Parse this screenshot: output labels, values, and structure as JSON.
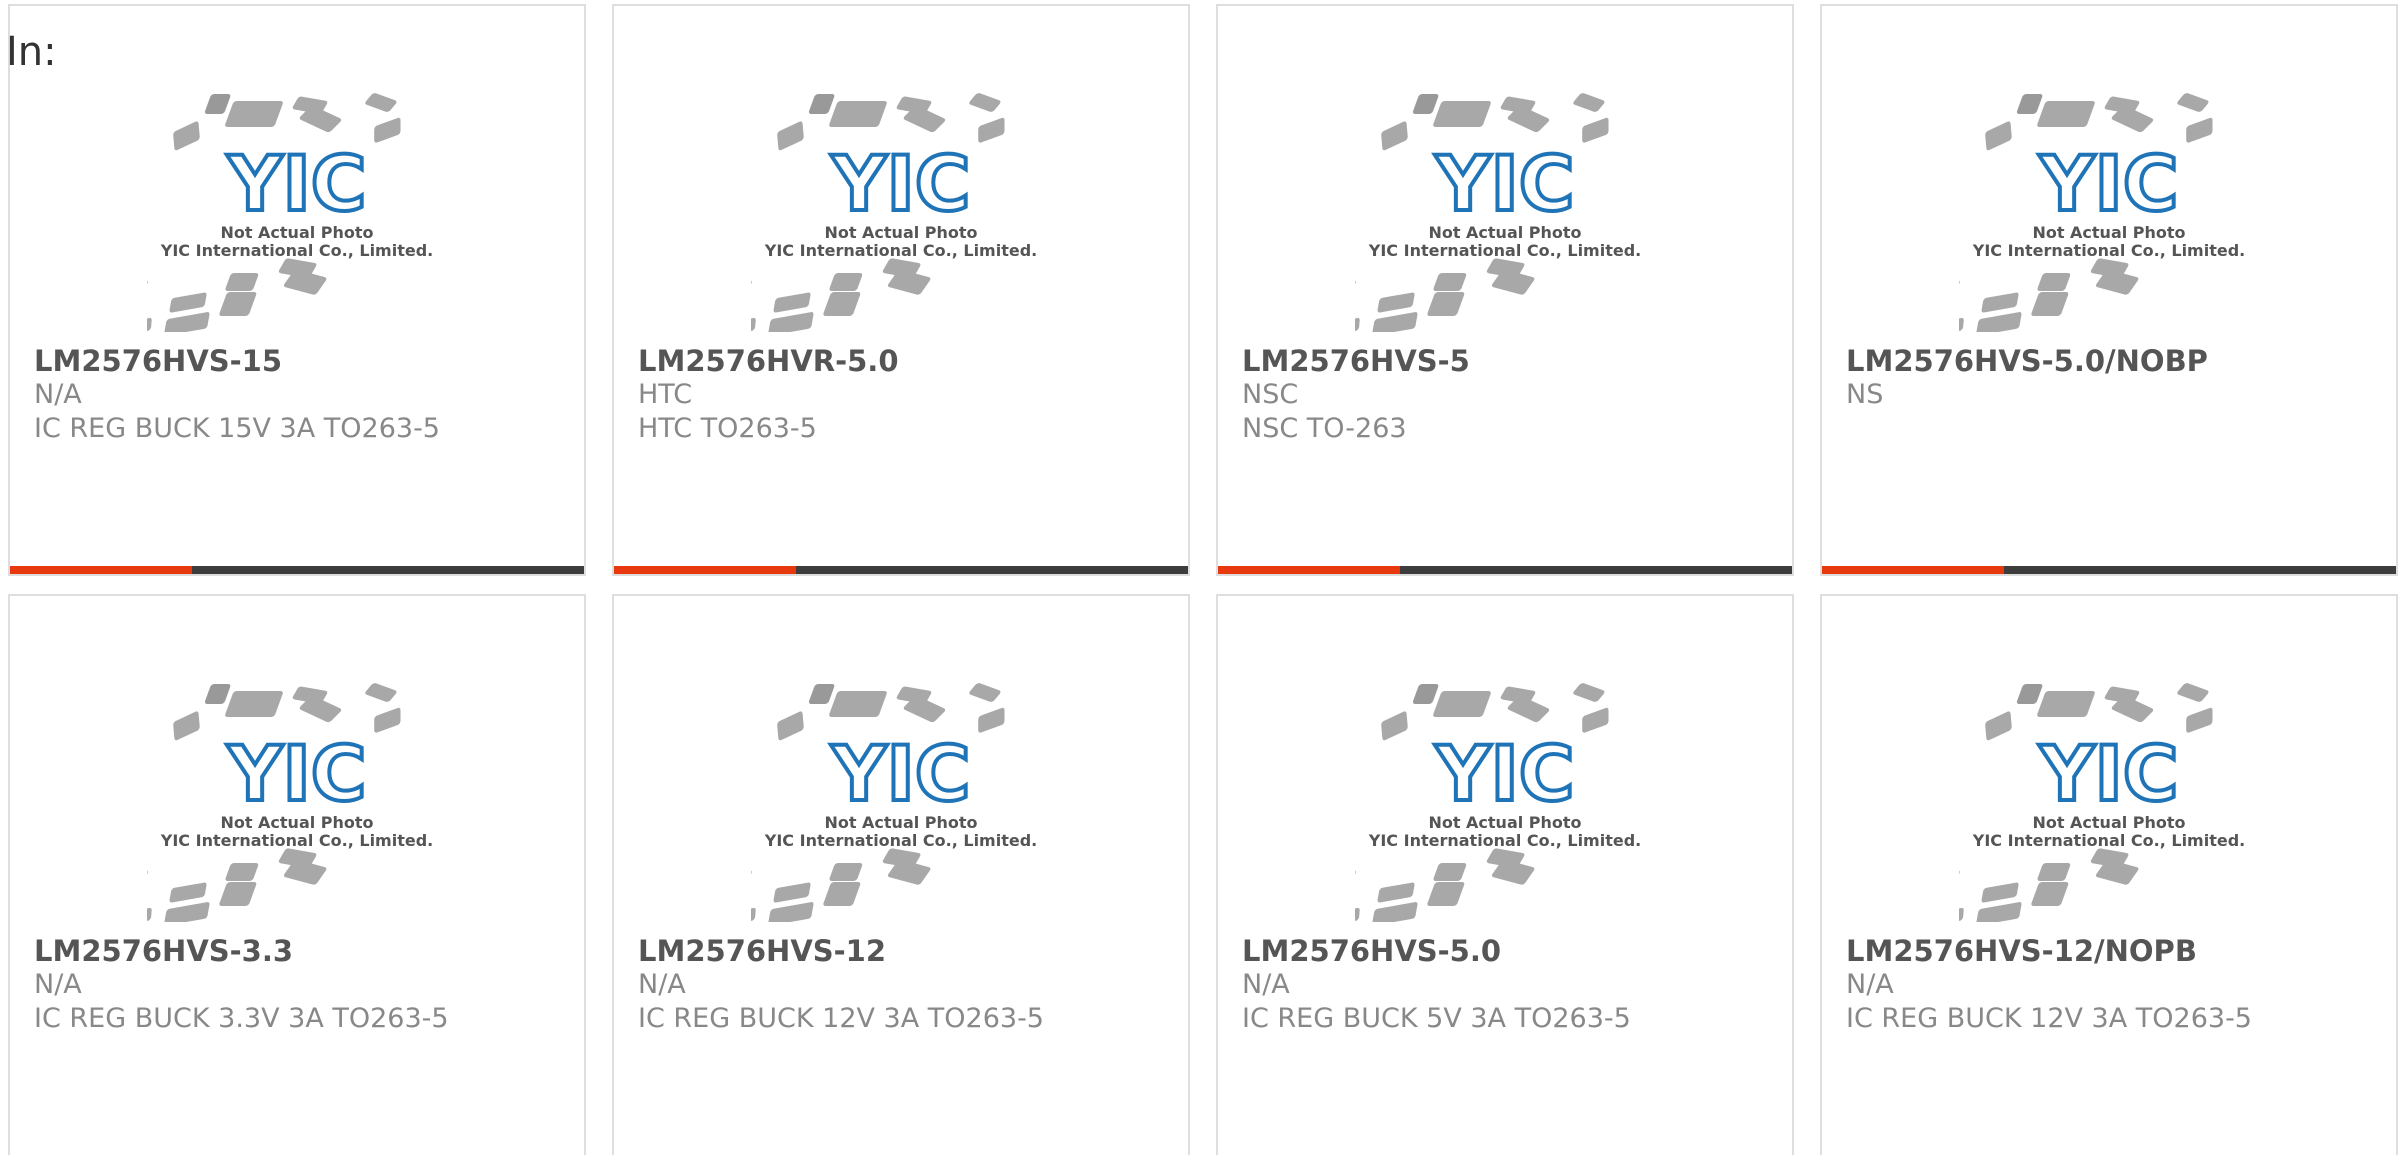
{
  "heading": "In:",
  "photo": {
    "caption_line1": "Not Actual Photo",
    "caption_line2": "YIC International Co., Limited.",
    "logo_text": "YIC",
    "logo_color": "#1f73b7",
    "chip_color": "#a8a8a8"
  },
  "colors": {
    "accent": "#e8380d",
    "bar": "#3d3d3d"
  },
  "products": [
    {
      "part": "LM2576HVS-15",
      "manufacturer": "N/A",
      "description": "IC REG BUCK 15V 3A TO263-5",
      "accent_bar": true
    },
    {
      "part": "LM2576HVR-5.0",
      "manufacturer": "HTC",
      "description": "HTC TO263-5",
      "accent_bar": true
    },
    {
      "part": "LM2576HVS-5",
      "manufacturer": "NSC",
      "description": "NSC TO-263",
      "accent_bar": true
    },
    {
      "part": "LM2576HVS-5.0/NOBP",
      "manufacturer": "NS",
      "description": "",
      "accent_bar": true
    },
    {
      "part": "LM2576HVS-3.3",
      "manufacturer": "N/A",
      "description": "IC REG BUCK 3.3V 3A TO263-5",
      "accent_bar": false
    },
    {
      "part": "LM2576HVS-12",
      "manufacturer": "N/A",
      "description": "IC REG BUCK 12V 3A TO263-5",
      "accent_bar": false
    },
    {
      "part": "LM2576HVS-5.0",
      "manufacturer": "N/A",
      "description": "IC REG BUCK 5V 3A TO263-5",
      "accent_bar": false
    },
    {
      "part": "LM2576HVS-12/NOPB",
      "manufacturer": "N/A",
      "description": "IC REG BUCK 12V 3A TO263-5",
      "accent_bar": false
    }
  ]
}
